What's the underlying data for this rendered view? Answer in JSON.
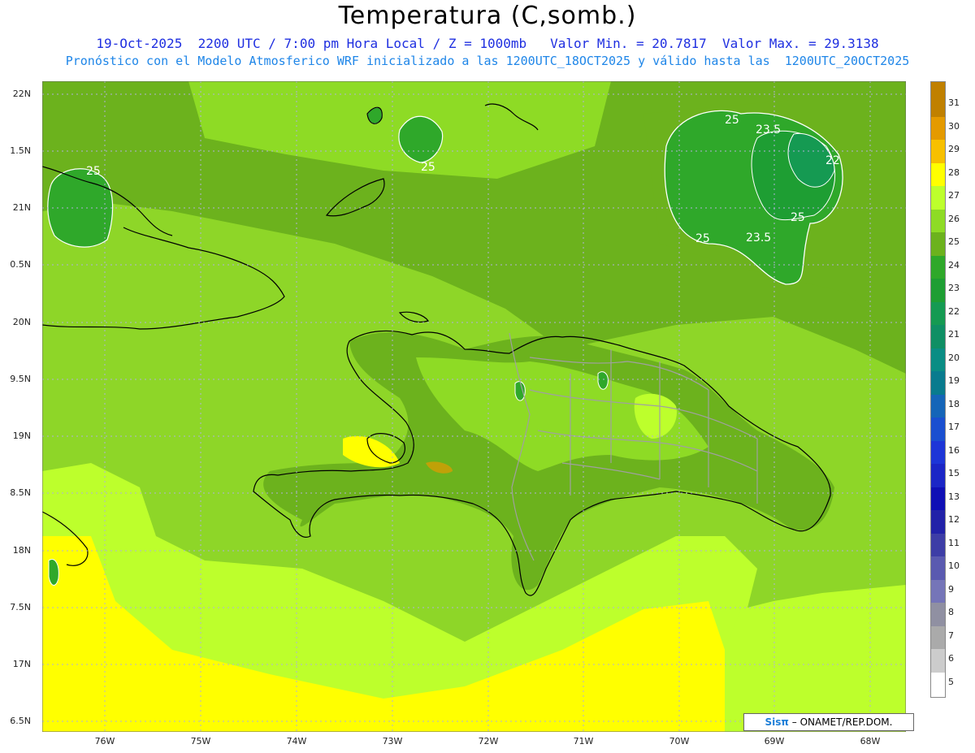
{
  "title": "Temperatura (C,somb.)",
  "subtitle1": "19-Oct-2025  2200 UTC / 7:00 pm Hora Local / Z = 1000mb   Valor Min. = 20.7817  Valor Max. = 29.3138",
  "subtitle2": "Pronóstico con el Modelo Atmosferico WRF inicializado a las 1200UTC_18OCT2025 y válido hasta las  1200UTC_20OCT2025",
  "lat_labels": [
    "22N",
    "1.5N",
    "21N",
    "0.5N",
    "20N",
    "9.5N",
    "19N",
    "8.5N",
    "18N",
    "7.5N",
    "17N",
    "6.5N"
  ],
  "lon_labels": [
    "76W",
    "75W",
    "74W",
    "73W",
    "72W",
    "71W",
    "70W",
    "69W",
    "68W"
  ],
  "colorbar": {
    "labels": [
      "31",
      "30",
      "29",
      "28",
      "27",
      "26",
      "25",
      "24",
      "23",
      "22",
      "21",
      "20",
      "19",
      "18",
      "17",
      "16",
      "15",
      "13",
      "12",
      "11",
      "10",
      "9",
      "8",
      "7",
      "6",
      "5"
    ],
    "colors": [
      "#c08000",
      "#e49a00",
      "#f7c000",
      "#ffff00",
      "#bdff2c",
      "#8edb25",
      "#6cb21d",
      "#2fa82a",
      "#1e9e33",
      "#159a52",
      "#0f8f64",
      "#0a8d84",
      "#097b8e",
      "#1565b8",
      "#1a4fd0",
      "#1d35d7",
      "#1b26c6",
      "#0f0fb5",
      "#2222a8",
      "#3d3da6",
      "#5a5ab0",
      "#7575b8",
      "#9090a2",
      "#aaaaaa",
      "#cccccc",
      "#ffffff"
    ]
  },
  "contour_labels": [
    "25",
    "25",
    "25",
    "23.5",
    "22",
    "25",
    "25",
    "23.5"
  ],
  "credit": {
    "brand": "Sisπ",
    "rest": "– ONAMET/REP.DOM."
  }
}
